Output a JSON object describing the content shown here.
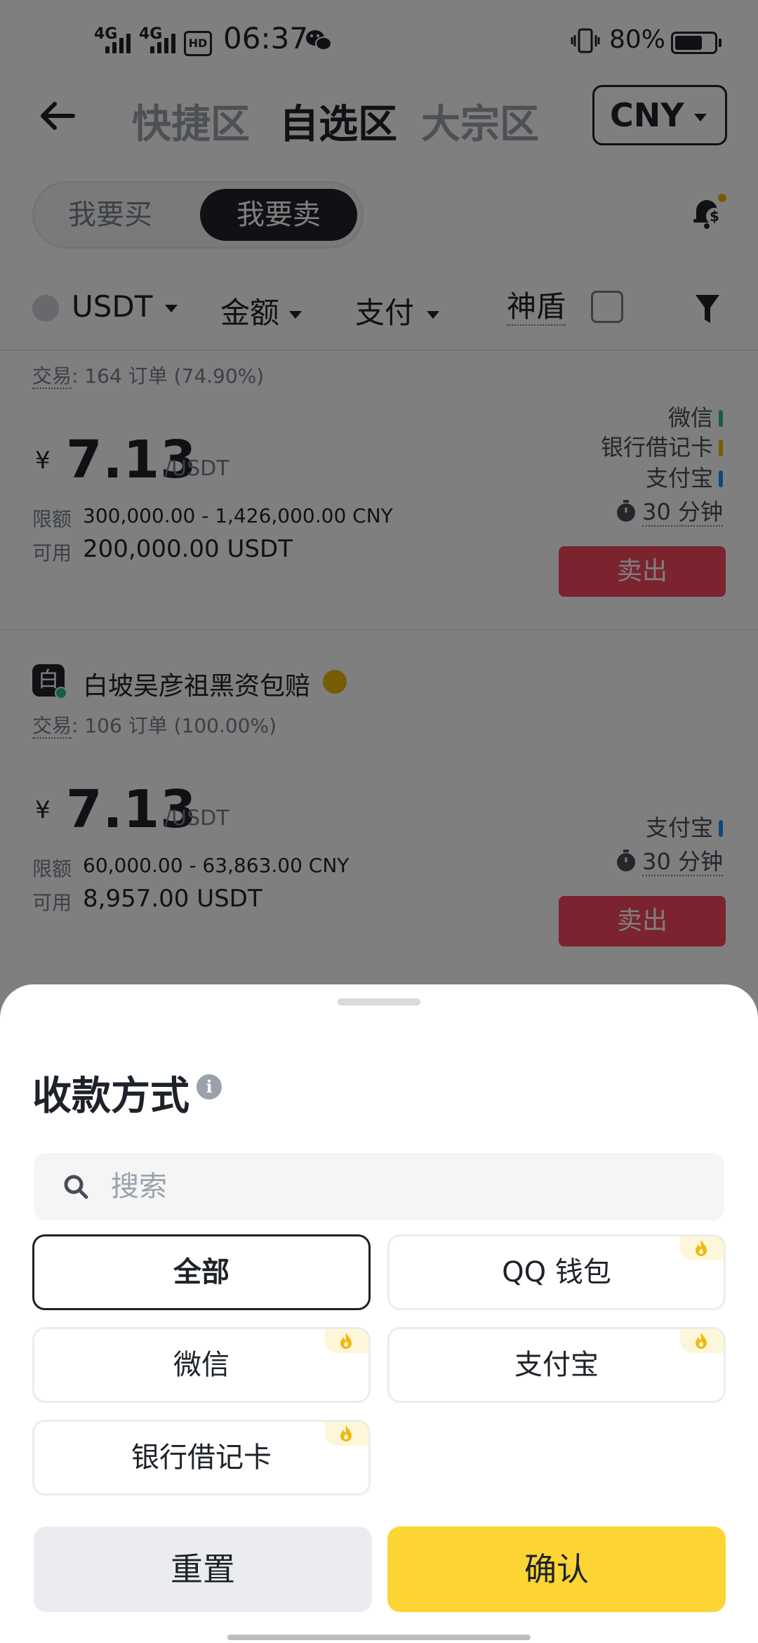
{
  "status_bar": {
    "signal_1": "4G",
    "signal_2": "4G",
    "hd_badge": "HD",
    "time": "06:37",
    "battery_percent": "80%",
    "battery_level": 0.8
  },
  "header": {
    "tabs": [
      {
        "label": "快捷区",
        "active": false
      },
      {
        "label": "自选区",
        "active": true
      },
      {
        "label": "大宗区",
        "active": false
      }
    ],
    "currency": "CNY"
  },
  "side_toggle": {
    "buy": "我要买",
    "sell": "我要卖",
    "active": "sell"
  },
  "filters": {
    "asset": "USDT",
    "amount": "金额",
    "payment": "支付",
    "shield": "神盾"
  },
  "ads": [
    {
      "merchant": "",
      "trades_label": "交易",
      "trades": "164 订单 (74.90%)",
      "currency_symbol": "¥",
      "price": "7.13",
      "unit": "/USDT",
      "limit_label": "限额",
      "limit": "300,000.00 - 1,426,000.00 CNY",
      "available_label": "可用",
      "available": "200,000.00 USDT",
      "payments": [
        "微信",
        "银行借记卡",
        "支付宝"
      ],
      "time_limit": "30 分钟",
      "action": "卖出"
    },
    {
      "merchant": "白坡吴彦祖黑资包赔",
      "avatar_letter": "白",
      "trades_label": "交易",
      "trades": "106 订单 (100.00%)",
      "currency_symbol": "¥",
      "price": "7.13",
      "unit": "/USDT",
      "limit_label": "限额",
      "limit": "60,000.00 - 63,863.00 CNY",
      "available_label": "可用",
      "available": "8,957.00 USDT",
      "payments": [
        "支付宝"
      ],
      "time_limit": "30 分钟",
      "action": "卖出"
    }
  ],
  "payment_colors": {
    "微信": "#2ebd85",
    "银行借记卡": "#f0b90b",
    "支付宝": "#1e90ff"
  },
  "sheet": {
    "title": "收款方式",
    "search_placeholder": "搜索",
    "search_value": "",
    "options": [
      {
        "label": "全部",
        "selected": true,
        "hot": false
      },
      {
        "label": "QQ 钱包",
        "selected": false,
        "hot": true
      },
      {
        "label": "微信",
        "selected": false,
        "hot": true
      },
      {
        "label": "支付宝",
        "selected": false,
        "hot": true
      },
      {
        "label": "银行借记卡",
        "selected": false,
        "hot": true
      }
    ],
    "reset": "重置",
    "confirm": "确认"
  },
  "colors": {
    "sell": "#f6465d",
    "confirm": "#fcd535",
    "text": "#1e2329"
  }
}
